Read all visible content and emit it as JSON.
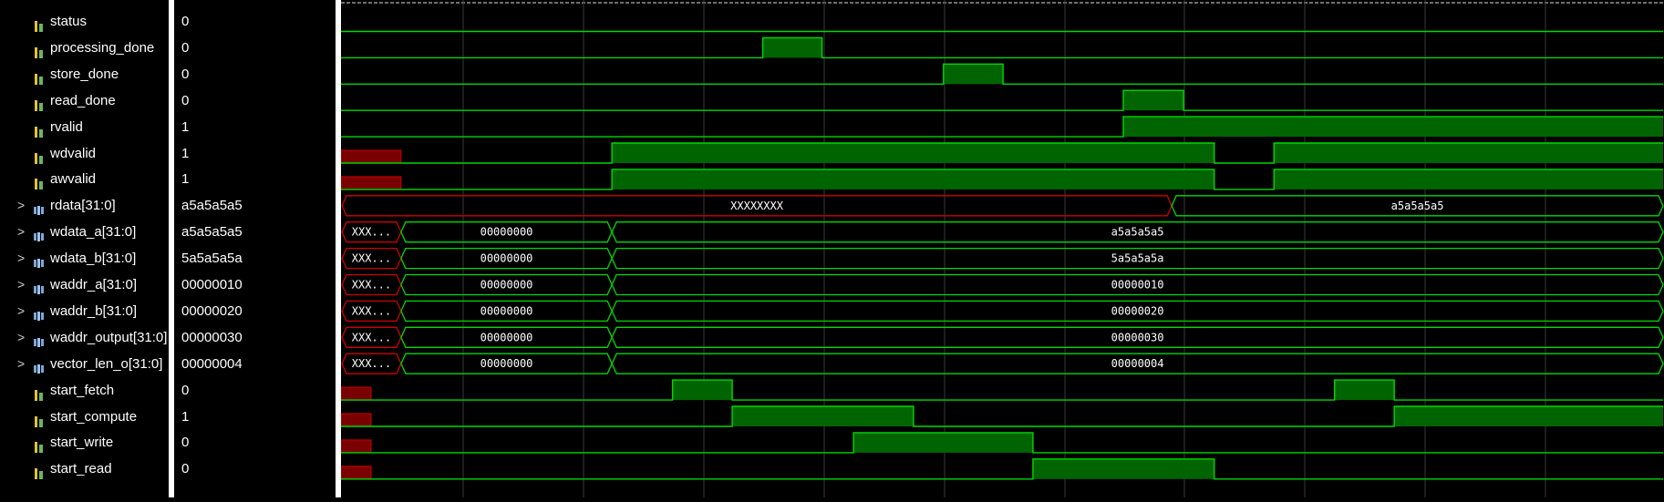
{
  "signals": [
    {
      "name": "status",
      "value": "0",
      "bus": false,
      "icon": "scalar-signal-icon"
    },
    {
      "name": "processing_done",
      "value": "0",
      "bus": false,
      "icon": "scalar-signal-icon"
    },
    {
      "name": "store_done",
      "value": "0",
      "bus": false,
      "icon": "scalar-signal-icon"
    },
    {
      "name": "read_done",
      "value": "0",
      "bus": false,
      "icon": "scalar-signal-icon"
    },
    {
      "name": "rvalid",
      "value": "1",
      "bus": false,
      "icon": "scalar-signal-icon"
    },
    {
      "name": "wdvalid",
      "value": "1",
      "bus": false,
      "icon": "scalar-signal-icon"
    },
    {
      "name": "awvalid",
      "value": "1",
      "bus": false,
      "icon": "scalar-signal-icon"
    },
    {
      "name": "rdata[31:0]",
      "value": "a5a5a5a5",
      "bus": true,
      "icon": "bus-signal-icon"
    },
    {
      "name": "wdata_a[31:0]",
      "value": "a5a5a5a5",
      "bus": true,
      "icon": "bus-signal-icon"
    },
    {
      "name": "wdata_b[31:0]",
      "value": "5a5a5a5a",
      "bus": true,
      "icon": "bus-signal-icon"
    },
    {
      "name": "waddr_a[31:0]",
      "value": "00000010",
      "bus": true,
      "icon": "bus-signal-icon"
    },
    {
      "name": "waddr_b[31:0]",
      "value": "00000020",
      "bus": true,
      "icon": "bus-signal-icon"
    },
    {
      "name": "waddr_output[31:0]",
      "value": "00000030",
      "bus": true,
      "icon": "bus-signal-icon"
    },
    {
      "name": "vector_len_o[31:0]",
      "value": "00000004",
      "bus": true,
      "icon": "bus-signal-icon"
    },
    {
      "name": "start_fetch",
      "value": "0",
      "bus": false,
      "icon": "scalar-signal-icon"
    },
    {
      "name": "start_compute",
      "value": "1",
      "bus": false,
      "icon": "scalar-signal-icon"
    },
    {
      "name": "start_write",
      "value": "0",
      "bus": false,
      "icon": "scalar-signal-icon"
    },
    {
      "name": "start_read",
      "value": "0",
      "bus": false,
      "icon": "scalar-signal-icon"
    }
  ],
  "expand_glyph": ">",
  "colors": {
    "wave": "#00d800",
    "fill": "#006400",
    "undefined": "#cc0000",
    "undefined_fill": "#7a0000",
    "grid": "#3a3a3a",
    "text": "#ffffff"
  },
  "waves": [
    {
      "type": "bit",
      "init": 0,
      "edges": []
    },
    {
      "type": "bit",
      "init": 0,
      "edges": [
        [
          0.3188,
          1
        ],
        [
          0.3636,
          0
        ]
      ]
    },
    {
      "type": "bit",
      "init": 0,
      "edges": [
        [
          0.4554,
          1
        ],
        [
          0.5004,
          0
        ]
      ]
    },
    {
      "type": "bit",
      "init": 0,
      "edges": [
        [
          0.5913,
          1
        ],
        [
          0.6369,
          0
        ]
      ]
    },
    {
      "type": "bit",
      "init": 0,
      "edges": [
        [
          0.5913,
          1
        ]
      ]
    },
    {
      "type": "bit",
      "init": "X",
      "edges": [
        [
          0.0454,
          0
        ],
        [
          0.2048,
          1
        ],
        [
          0.66,
          0
        ],
        [
          0.7052,
          1
        ]
      ]
    },
    {
      "type": "bit",
      "init": "X",
      "edges": [
        [
          0.0454,
          0
        ],
        [
          0.2048,
          1
        ],
        [
          0.66,
          0
        ],
        [
          0.7052,
          1
        ]
      ]
    },
    {
      "type": "bus",
      "segs": [
        {
          "t0": 0,
          "t1": 0.6279,
          "v": "XXXXXXXX",
          "undef": true
        },
        {
          "t0": 0.6279,
          "t1": 1.0,
          "v": "a5a5a5a5",
          "undef": false
        }
      ]
    },
    {
      "type": "bus",
      "segs": [
        {
          "t0": 0,
          "t1": 0.0454,
          "v": "XXX...",
          "undef": true
        },
        {
          "t0": 0.0454,
          "t1": 0.2048,
          "v": "00000000",
          "undef": false
        },
        {
          "t0": 0.2048,
          "t1": 1.0,
          "v": "a5a5a5a5",
          "undef": false
        }
      ]
    },
    {
      "type": "bus",
      "segs": [
        {
          "t0": 0,
          "t1": 0.0454,
          "v": "XXX...",
          "undef": true
        },
        {
          "t0": 0.0454,
          "t1": 0.2048,
          "v": "00000000",
          "undef": false
        },
        {
          "t0": 0.2048,
          "t1": 1.0,
          "v": "5a5a5a5a",
          "undef": false
        }
      ]
    },
    {
      "type": "bus",
      "segs": [
        {
          "t0": 0,
          "t1": 0.0454,
          "v": "XXX...",
          "undef": true
        },
        {
          "t0": 0.0454,
          "t1": 0.2048,
          "v": "00000000",
          "undef": false
        },
        {
          "t0": 0.2048,
          "t1": 1.0,
          "v": "00000010",
          "undef": false
        }
      ]
    },
    {
      "type": "bus",
      "segs": [
        {
          "t0": 0,
          "t1": 0.0454,
          "v": "XXX...",
          "undef": true
        },
        {
          "t0": 0.0454,
          "t1": 0.2048,
          "v": "00000000",
          "undef": false
        },
        {
          "t0": 0.2048,
          "t1": 1.0,
          "v": "00000020",
          "undef": false
        }
      ]
    },
    {
      "type": "bus",
      "segs": [
        {
          "t0": 0,
          "t1": 0.0454,
          "v": "XXX...",
          "undef": true
        },
        {
          "t0": 0.0454,
          "t1": 0.2048,
          "v": "00000000",
          "undef": false
        },
        {
          "t0": 0.2048,
          "t1": 1.0,
          "v": "00000030",
          "undef": false
        }
      ]
    },
    {
      "type": "bus",
      "segs": [
        {
          "t0": 0,
          "t1": 0.0454,
          "v": "XXX...",
          "undef": true
        },
        {
          "t0": 0.0454,
          "t1": 0.2048,
          "v": "00000000",
          "undef": false
        },
        {
          "t0": 0.2048,
          "t1": 1.0,
          "v": "00000004",
          "undef": false
        }
      ]
    },
    {
      "type": "bit",
      "init": "X",
      "edges": [
        [
          0.0227,
          0
        ],
        [
          0.2506,
          1
        ],
        [
          0.2957,
          0
        ],
        [
          0.751,
          1
        ],
        [
          0.7961,
          0
        ]
      ]
    },
    {
      "type": "bit",
      "init": "X",
      "edges": [
        [
          0.0227,
          0
        ],
        [
          0.2957,
          1
        ],
        [
          0.4327,
          0
        ],
        [
          0.7961,
          1
        ]
      ]
    },
    {
      "type": "bit",
      "init": "X",
      "edges": [
        [
          0.0227,
          0
        ],
        [
          0.3874,
          1
        ],
        [
          0.523,
          0
        ]
      ]
    },
    {
      "type": "bit",
      "init": "X",
      "edges": [
        [
          0.0227,
          0
        ],
        [
          0.523,
          1
        ],
        [
          0.66,
          0
        ]
      ]
    }
  ]
}
